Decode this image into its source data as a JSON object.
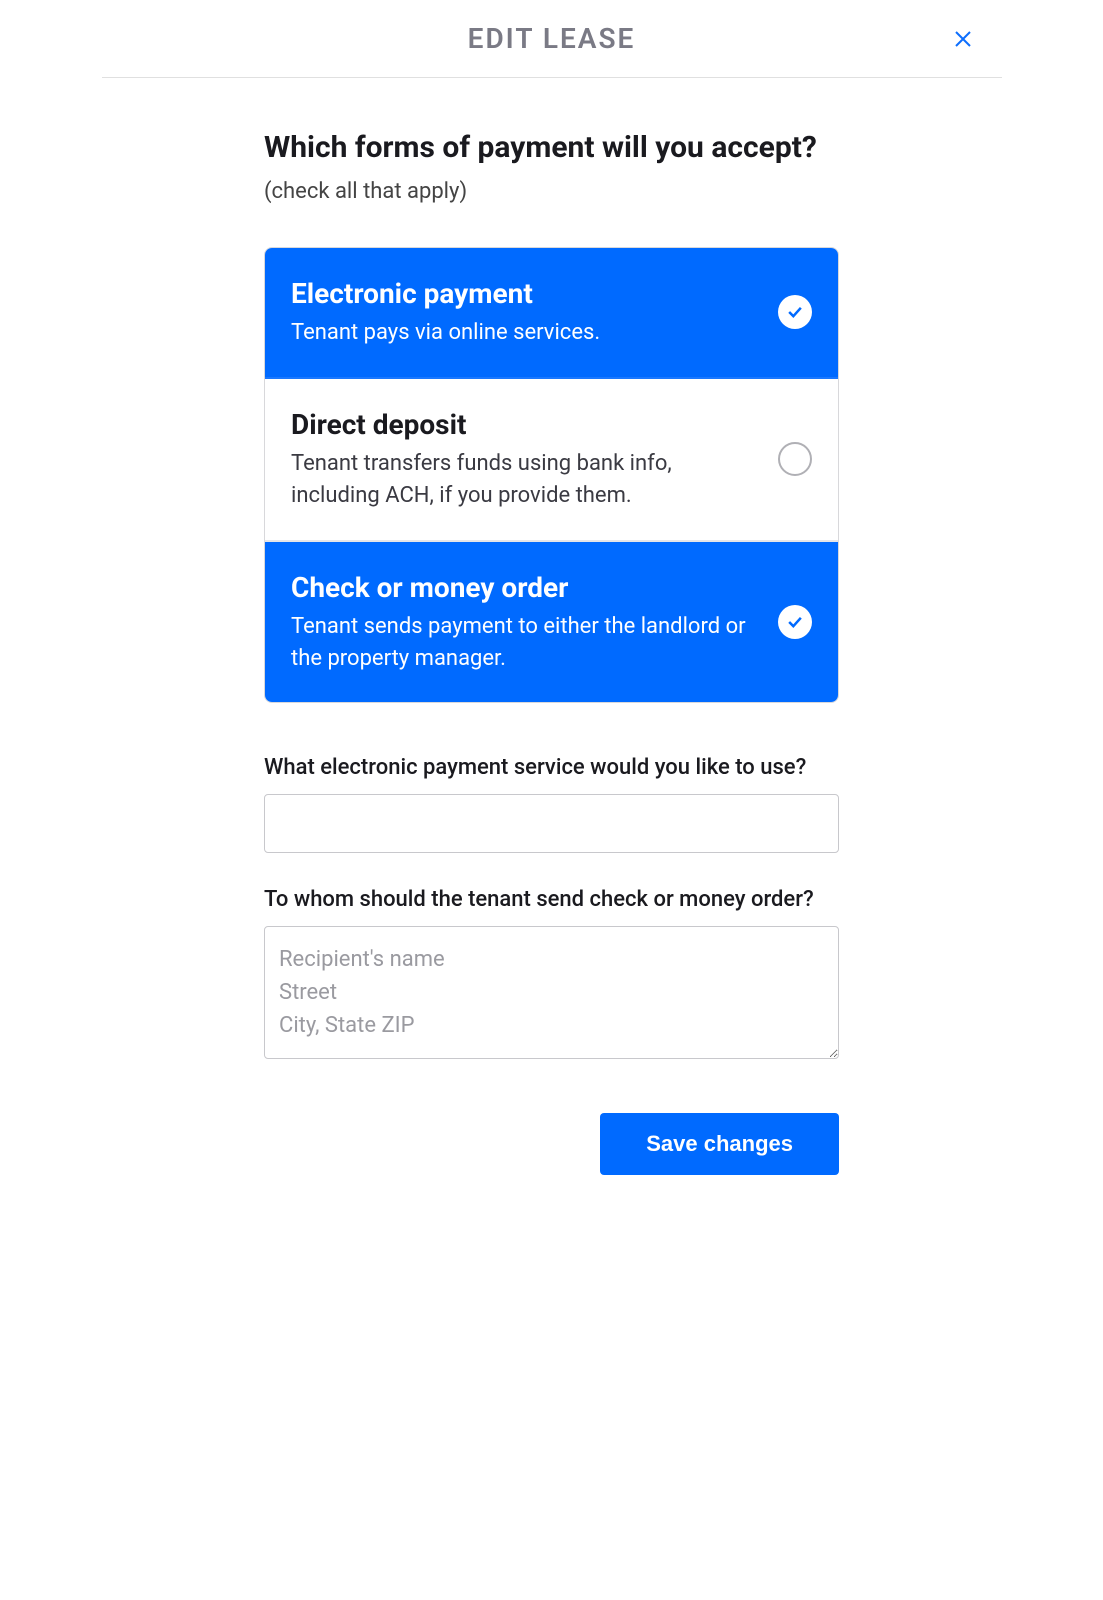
{
  "header": {
    "title": "EDIT LEASE"
  },
  "question": {
    "main": "Which forms of payment will you accept?",
    "sub": "(check all that apply)"
  },
  "options": [
    {
      "title": "Electronic payment",
      "desc": "Tenant pays via online services.",
      "selected": true
    },
    {
      "title": "Direct deposit",
      "desc": "Tenant transfers funds using bank info, including ACH, if you provide them.",
      "selected": false
    },
    {
      "title": "Check or money order",
      "desc": "Tenant sends payment to either the landlord or the property manager.",
      "selected": true
    }
  ],
  "fields": {
    "electronic_service": {
      "label": "What electronic payment service would you like to use?",
      "value": ""
    },
    "check_recipient": {
      "label": "To whom should the tenant send check or money order?",
      "placeholder": "Recipient's name\nStreet\nCity, State ZIP",
      "value": ""
    }
  },
  "actions": {
    "save_label": "Save changes"
  }
}
